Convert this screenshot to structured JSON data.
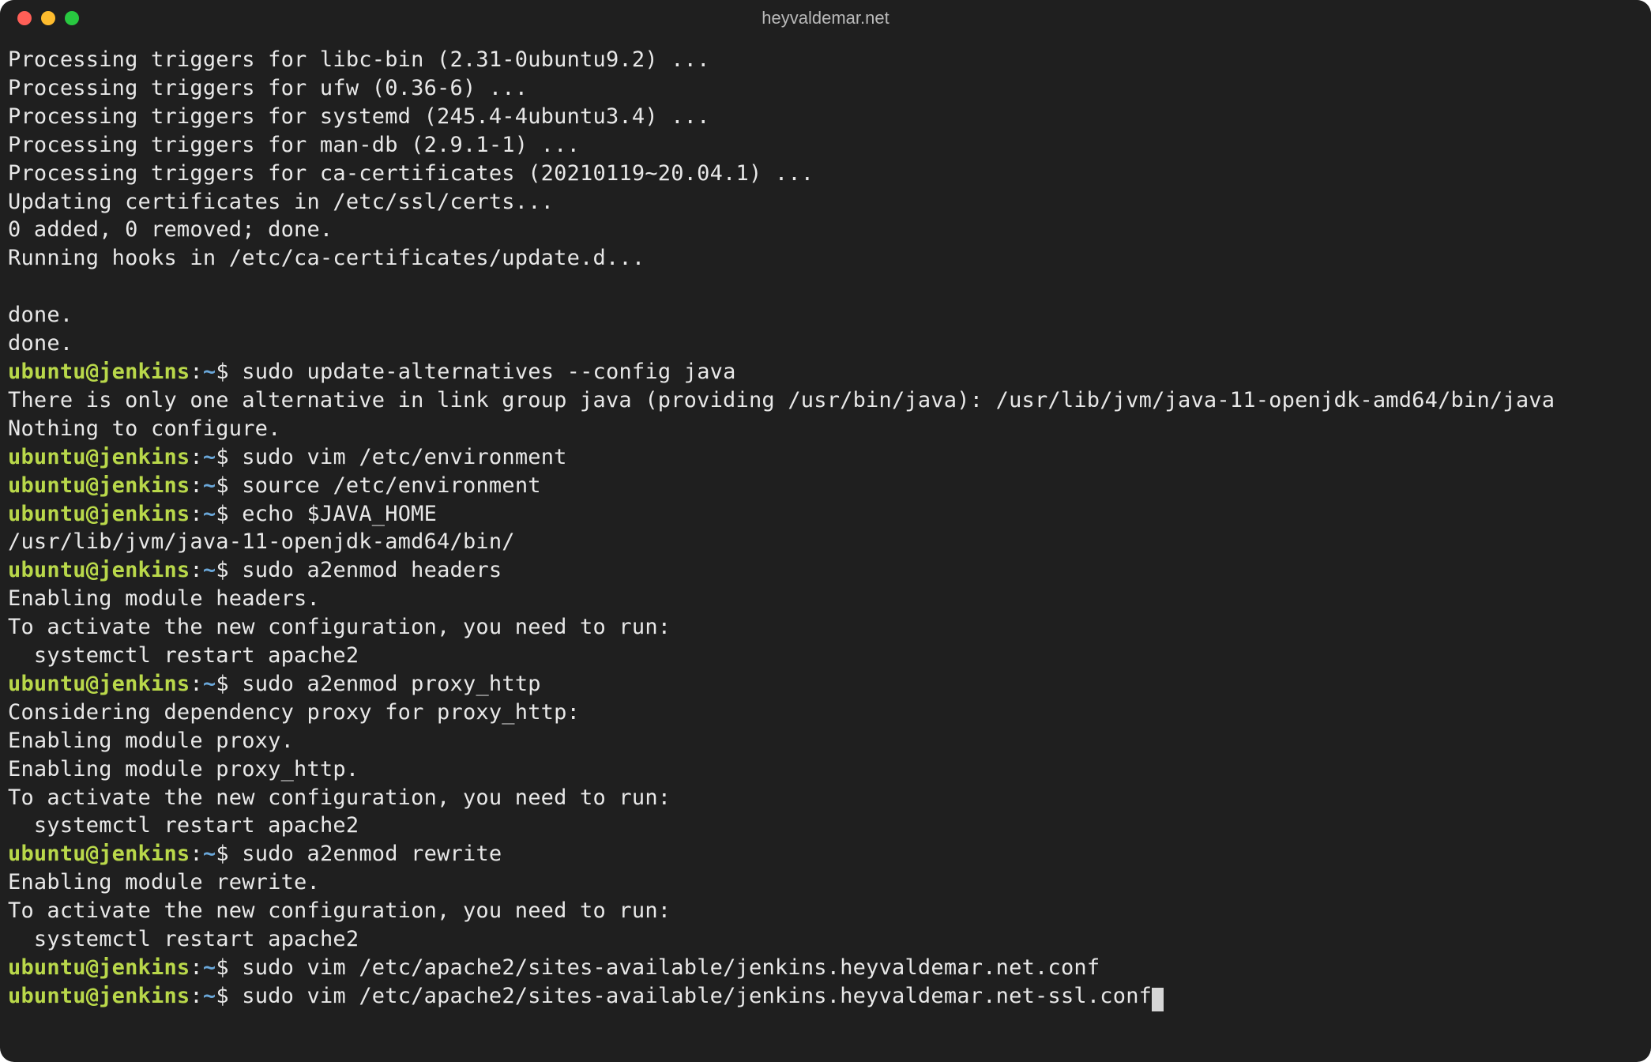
{
  "window": {
    "title": "heyvaldemar.net"
  },
  "prompt": {
    "user_host": "ubuntu@jenkins",
    "sep": ":",
    "path": "~",
    "dollar": "$"
  },
  "lines": [
    {
      "type": "out",
      "text": "Processing triggers for libc-bin (2.31-0ubuntu9.2) ..."
    },
    {
      "type": "out",
      "text": "Processing triggers for ufw (0.36-6) ..."
    },
    {
      "type": "out",
      "text": "Processing triggers for systemd (245.4-4ubuntu3.4) ..."
    },
    {
      "type": "out",
      "text": "Processing triggers for man-db (2.9.1-1) ..."
    },
    {
      "type": "out",
      "text": "Processing triggers for ca-certificates (20210119~20.04.1) ..."
    },
    {
      "type": "out",
      "text": "Updating certificates in /etc/ssl/certs..."
    },
    {
      "type": "out",
      "text": "0 added, 0 removed; done."
    },
    {
      "type": "out",
      "text": "Running hooks in /etc/ca-certificates/update.d..."
    },
    {
      "type": "out",
      "text": ""
    },
    {
      "type": "out",
      "text": "done."
    },
    {
      "type": "out",
      "text": "done."
    },
    {
      "type": "cmd",
      "text": "sudo update-alternatives --config java"
    },
    {
      "type": "out",
      "text": "There is only one alternative in link group java (providing /usr/bin/java): /usr/lib/jvm/java-11-openjdk-amd64/bin/java"
    },
    {
      "type": "out",
      "text": "Nothing to configure."
    },
    {
      "type": "cmd",
      "text": "sudo vim /etc/environment"
    },
    {
      "type": "cmd",
      "text": "source /etc/environment"
    },
    {
      "type": "cmd",
      "text": "echo $JAVA_HOME"
    },
    {
      "type": "out",
      "text": "/usr/lib/jvm/java-11-openjdk-amd64/bin/"
    },
    {
      "type": "cmd",
      "text": "sudo a2enmod headers"
    },
    {
      "type": "out",
      "text": "Enabling module headers."
    },
    {
      "type": "out",
      "text": "To activate the new configuration, you need to run:"
    },
    {
      "type": "out",
      "text": "  systemctl restart apache2"
    },
    {
      "type": "cmd",
      "text": "sudo a2enmod proxy_http"
    },
    {
      "type": "out",
      "text": "Considering dependency proxy for proxy_http:"
    },
    {
      "type": "out",
      "text": "Enabling module proxy."
    },
    {
      "type": "out",
      "text": "Enabling module proxy_http."
    },
    {
      "type": "out",
      "text": "To activate the new configuration, you need to run:"
    },
    {
      "type": "out",
      "text": "  systemctl restart apache2"
    },
    {
      "type": "cmd",
      "text": "sudo a2enmod rewrite"
    },
    {
      "type": "out",
      "text": "Enabling module rewrite."
    },
    {
      "type": "out",
      "text": "To activate the new configuration, you need to run:"
    },
    {
      "type": "out",
      "text": "  systemctl restart apache2"
    },
    {
      "type": "cmd",
      "text": "sudo vim /etc/apache2/sites-available/jenkins.heyvaldemar.net.conf"
    },
    {
      "type": "cmd",
      "text": "sudo vim /etc/apache2/sites-available/jenkins.heyvaldemar.net-ssl.conf",
      "cursor": true
    }
  ]
}
